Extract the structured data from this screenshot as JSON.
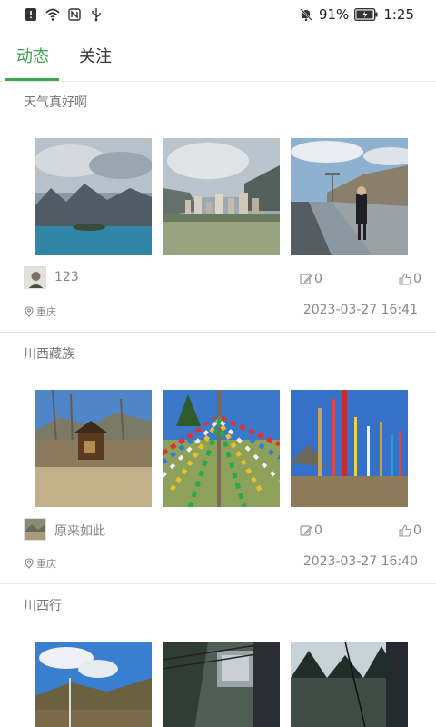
{
  "status_bar": {
    "icons_left": [
      "alert-icon",
      "wifi-icon",
      "nfc-icon",
      "usb-icon"
    ],
    "icons_right": [
      "mute-bell-icon",
      "battery-icon"
    ],
    "battery_percent": "91%",
    "time": "1:25"
  },
  "tabs": [
    {
      "label": "动态",
      "active": true
    },
    {
      "label": "关注",
      "active": false
    }
  ],
  "accent_color": "#3aa84b",
  "posts": [
    {
      "title": "天气真好啊",
      "photos": [
        "lake-mountains-photo",
        "city-valley-photo",
        "man-on-road-photo"
      ],
      "user_name": "123",
      "comment_count": "0",
      "like_count": "0",
      "location": "重庆",
      "timestamp": "2023-03-27 16:41"
    },
    {
      "title": "川西藏族",
      "photos": [
        "wooden-hut-photo",
        "prayer-flags-tree-photo",
        "prayer-flag-poles-photo"
      ],
      "user_name": "原来如此",
      "comment_count": "0",
      "like_count": "0",
      "location": "重庆",
      "timestamp": "2023-03-27 16:40"
    },
    {
      "title": "川西行",
      "photos": [
        "hillside-sky-photo",
        "cable-car-photo",
        "forest-window-photo"
      ]
    }
  ]
}
